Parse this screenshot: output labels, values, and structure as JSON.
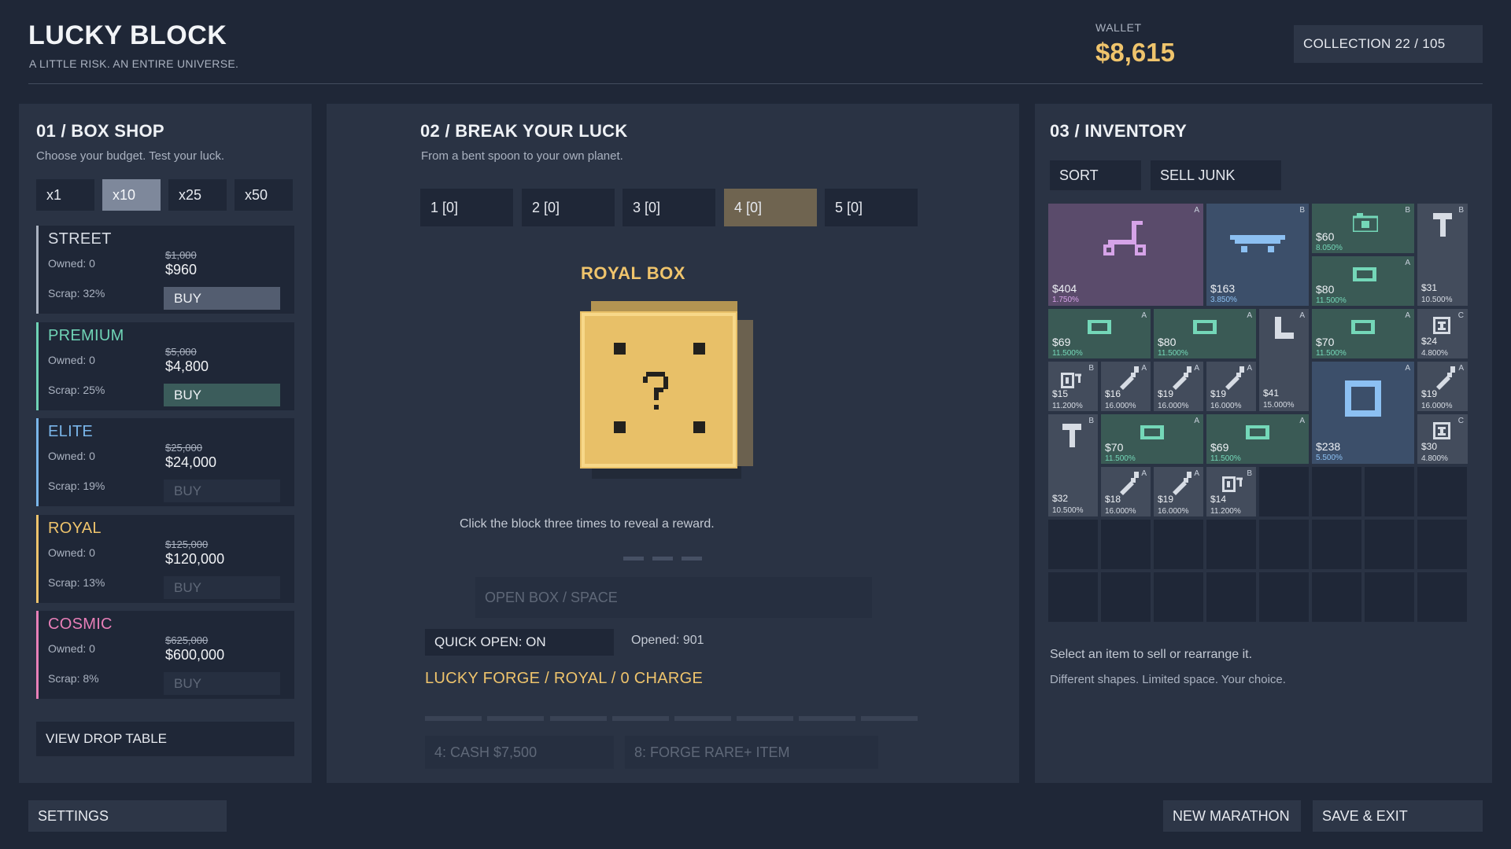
{
  "header": {
    "title": "LUCKY BLOCK",
    "subtitle": "A LITTLE RISK. AN ENTIRE UNIVERSE.",
    "wallet_label": "WALLET",
    "wallet_value": "$8,615",
    "collection": "COLLECTION  22 / 105"
  },
  "shop": {
    "title": "01 / BOX SHOP",
    "subtitle": "Choose your budget. Test your luck.",
    "quantities": [
      "x1",
      "x10",
      "x25",
      "x50"
    ],
    "selected_quantity": "x10",
    "boxes": [
      {
        "name": "STREET",
        "owned": "Owned: 0",
        "scrap": "Scrap: 32%",
        "old_price": "$1,000",
        "price": "$960",
        "buy": "BUY",
        "color": "#aab2c0",
        "enabled": true
      },
      {
        "name": "PREMIUM",
        "owned": "Owned: 0",
        "scrap": "Scrap: 25%",
        "old_price": "$5,000",
        "price": "$4,800",
        "buy": "BUY",
        "color": "#6fd3b5",
        "enabled": true
      },
      {
        "name": "ELITE",
        "owned": "Owned: 0",
        "scrap": "Scrap: 19%",
        "old_price": "$25,000",
        "price": "$24,000",
        "buy": "BUY",
        "color": "#7ab6ea",
        "enabled": false
      },
      {
        "name": "ROYAL",
        "owned": "Owned: 0",
        "scrap": "Scrap: 13%",
        "old_price": "$125,000",
        "price": "$120,000",
        "buy": "BUY",
        "color": "#efc46c",
        "enabled": false
      },
      {
        "name": "COSMIC",
        "owned": "Owned: 0",
        "scrap": "Scrap: 8%",
        "old_price": "$625,000",
        "price": "$600,000",
        "buy": "BUY",
        "color": "#e87fb8",
        "enabled": false
      }
    ],
    "view_drop_table": "VIEW DROP TABLE"
  },
  "break": {
    "title": "02 / BREAK YOUR LUCK",
    "subtitle": "From a bent spoon to your own planet.",
    "slots": [
      "1  [0]",
      "2  [0]",
      "3  [0]",
      "4  [0]",
      "5  [0]"
    ],
    "active_slot": "4  [0]",
    "box_name": "ROYAL BOX",
    "hint": "Click the block three times to reveal a reward.",
    "open_button": "OPEN BOX  /  SPACE",
    "quick_open": "QUICK OPEN: ON",
    "opened": "Opened: 901",
    "forge": "LUCKY FORGE / ROYAL / 0 CHARGE",
    "rewards": [
      "4: CASH $7,500",
      "8: FORGE RARE+ ITEM"
    ]
  },
  "inventory": {
    "title": "03 / INVENTORY",
    "sort": "SORT",
    "sell_junk": "SELL JUNK",
    "items": [
      {
        "icon": "scooter-icon",
        "price": "$404",
        "pct": "1.750%",
        "rank": "A",
        "rarity": "purple"
      },
      {
        "icon": "skateboard-icon",
        "price": "$163",
        "pct": "3.850%",
        "rank": "B",
        "rarity": "blue"
      },
      {
        "icon": "camera-icon",
        "price": "$60",
        "pct": "8.050%",
        "rank": "B",
        "rarity": "green"
      },
      {
        "icon": "hammer-icon",
        "price": "$31",
        "pct": "10.500%",
        "rank": "B",
        "rarity": "gray"
      },
      {
        "icon": "cash-icon",
        "price": "$80",
        "pct": "11.500%",
        "rank": "A",
        "rarity": "green"
      },
      {
        "icon": "cash-icon",
        "price": "$69",
        "pct": "11.500%",
        "rank": "A",
        "rarity": "green"
      },
      {
        "icon": "cash-icon",
        "price": "$80",
        "pct": "11.500%",
        "rank": "A",
        "rarity": "green"
      },
      {
        "icon": "sock-icon",
        "price": "$41",
        "pct": "15.000%",
        "rank": "A",
        "rarity": "gray"
      },
      {
        "icon": "cash-icon",
        "price": "$70",
        "pct": "11.500%",
        "rank": "A",
        "rarity": "green"
      },
      {
        "icon": "spool-icon",
        "price": "$24",
        "pct": "4.800%",
        "rank": "C",
        "rarity": "gray"
      },
      {
        "icon": "ticket-icon",
        "price": "$15",
        "pct": "11.200%",
        "rank": "B",
        "rarity": "gray"
      },
      {
        "icon": "spoon-icon",
        "price": "$16",
        "pct": "16.000%",
        "rank": "A",
        "rarity": "gray"
      },
      {
        "icon": "spoon-icon",
        "price": "$19",
        "pct": "16.000%",
        "rank": "A",
        "rarity": "gray"
      },
      {
        "icon": "spoon-icon",
        "price": "$19",
        "pct": "16.000%",
        "rank": "A",
        "rarity": "gray"
      },
      {
        "icon": "frame-icon",
        "price": "$238",
        "pct": "5.500%",
        "rank": "A",
        "rarity": "blue"
      },
      {
        "icon": "spoon-icon",
        "price": "$19",
        "pct": "16.000%",
        "rank": "A",
        "rarity": "gray"
      },
      {
        "icon": "hammer-icon",
        "price": "$32",
        "pct": "10.500%",
        "rank": "B",
        "rarity": "gray"
      },
      {
        "icon": "cash-icon",
        "price": "$70",
        "pct": "11.500%",
        "rank": "A",
        "rarity": "green"
      },
      {
        "icon": "cash-icon",
        "price": "$69",
        "pct": "11.500%",
        "rank": "A",
        "rarity": "green"
      },
      {
        "icon": "spool-icon",
        "price": "$30",
        "pct": "4.800%",
        "rank": "C",
        "rarity": "gray"
      },
      {
        "icon": "spoon-icon",
        "price": "$18",
        "pct": "16.000%",
        "rank": "A",
        "rarity": "gray"
      },
      {
        "icon": "spoon-icon",
        "price": "$19",
        "pct": "16.000%",
        "rank": "A",
        "rarity": "gray"
      },
      {
        "icon": "ticket-icon",
        "price": "$14",
        "pct": "11.200%",
        "rank": "B",
        "rarity": "gray"
      }
    ],
    "note": "Select an item to sell or rearrange it.",
    "note2": "Different shapes. Limited space. Your choice."
  },
  "footer": {
    "settings": "SETTINGS",
    "new_marathon": "NEW MARATHON",
    "save_exit": "SAVE & EXIT"
  },
  "colors": {
    "background": "#1f2737",
    "panel": "#2a3344",
    "accent_gold": "#efc46c",
    "rarity_purple": "#5a4b6b",
    "rarity_blue": "#3c4f6a",
    "rarity_green": "#3a5a55",
    "rarity_gray": "#434c5c"
  }
}
